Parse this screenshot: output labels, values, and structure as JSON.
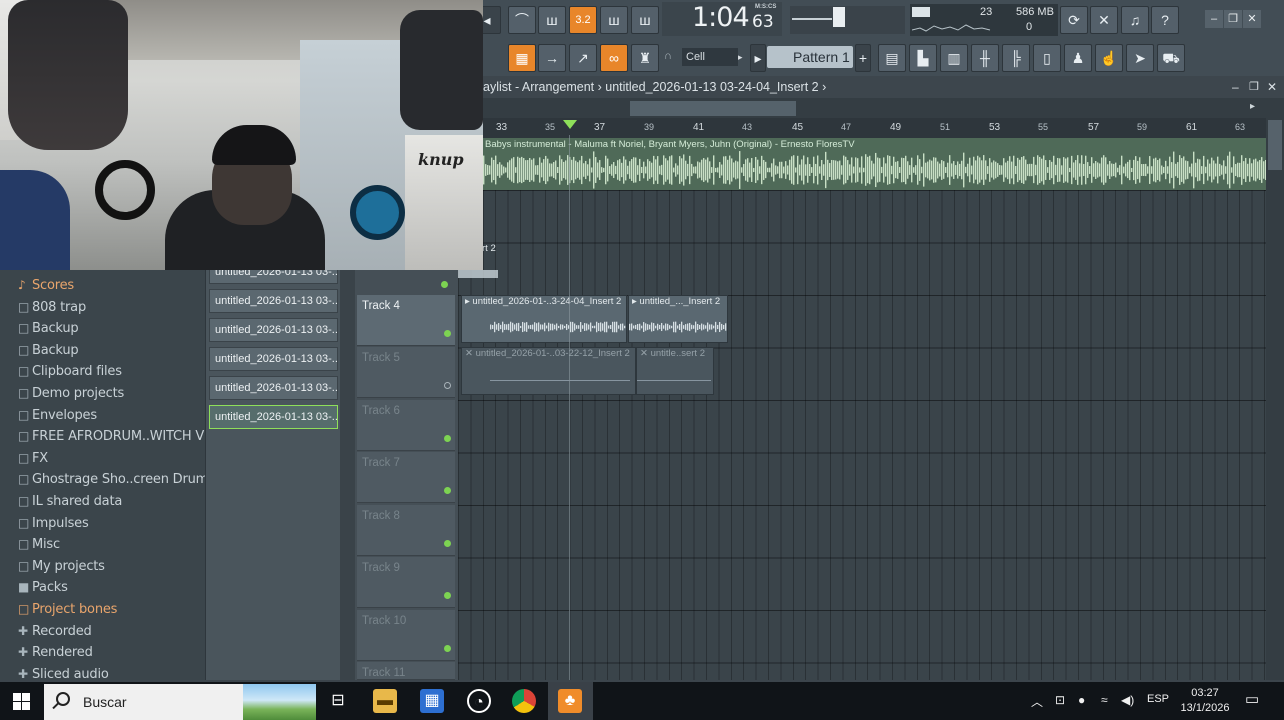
{
  "toolbar": {
    "time_main": "1:04",
    "time_sub": "63",
    "time_unit": "M:S:CS",
    "cpu_value": "23",
    "ram_value": "586 MB",
    "voices_value": "0",
    "snap_value": "Cell",
    "pattern_label": "Pattern 1",
    "tempo_snippet": "3.2"
  },
  "playlist": {
    "title": "aylist - Arrangement › untitled_2026-01-13 03-24-04_Insert 2 ›",
    "ruler": [
      "33",
      "35",
      "37",
      "39",
      "41",
      "43",
      "45",
      "47",
      "49",
      "51",
      "53",
      "55",
      "57",
      "59",
      "61",
      "63"
    ],
    "audio_track_label": "Babys instrumental - Maluma ft  Noriel, Bryant Myers, Juhn (Original) - Ernesto FloresTV",
    "partial_clip_label": "rt 2",
    "tracks": [
      {
        "name": "Track 4",
        "active": true
      },
      {
        "name": "Track 5",
        "active": false
      },
      {
        "name": "Track 6",
        "active": false
      },
      {
        "name": "Track 7",
        "active": false
      },
      {
        "name": "Track 8",
        "active": false
      },
      {
        "name": "Track 9",
        "active": false
      },
      {
        "name": "Track 10",
        "active": false
      },
      {
        "name": "Track 11",
        "active": false
      }
    ],
    "clips": {
      "track4_a": "▸ untitled_2026-01-..3-24-04_Insert 2",
      "track4_b": "▸ untitled_..._Insert 2",
      "track5_a": "✕ untitled_2026-01-..03-22-12_Insert 2",
      "track5_b": "✕ untitle..sert 2"
    }
  },
  "browser": {
    "items": [
      {
        "label": "Scores",
        "icon": "♪",
        "orange": true
      },
      {
        "label": "808 trap",
        "icon": "□",
        "orange": false
      },
      {
        "label": "Backup",
        "icon": "□",
        "orange": false
      },
      {
        "label": "Backup",
        "icon": "□",
        "orange": false
      },
      {
        "label": "Clipboard files",
        "icon": "□",
        "orange": false
      },
      {
        "label": "Demo projects",
        "icon": "□",
        "orange": false
      },
      {
        "label": "Envelopes",
        "icon": "□",
        "orange": false
      },
      {
        "label": "FREE AFRODRUM..WITCH VIBEZ",
        "icon": "□",
        "orange": false
      },
      {
        "label": "FX",
        "icon": "□",
        "orange": false
      },
      {
        "label": "Ghostrage Sho..creen Drum Kit",
        "icon": "□",
        "orange": false
      },
      {
        "label": "IL shared data",
        "icon": "□",
        "orange": false
      },
      {
        "label": "Impulses",
        "icon": "□",
        "orange": false
      },
      {
        "label": "Misc",
        "icon": "□",
        "orange": false
      },
      {
        "label": "My projects",
        "icon": "□",
        "orange": false
      },
      {
        "label": "Packs",
        "icon": "■",
        "orange": false
      },
      {
        "label": "Project bones",
        "icon": "□",
        "orange": true
      },
      {
        "label": "Recorded",
        "icon": "✚",
        "orange": false
      },
      {
        "label": "Rendered",
        "icon": "✚",
        "orange": false
      },
      {
        "label": "Sliced audio",
        "icon": "✚",
        "orange": false
      }
    ],
    "files": [
      "untitled_2026-01-13 03-...",
      "untitled_2026-01-13 03-...",
      "untitled_2026-01-13 03-...",
      "untitled_2026-01-13 03-...",
      "untitled_2026-01-13 03-...",
      "untitled_2026-01-13 03-..."
    ]
  },
  "webcam": {
    "box_text": "knup"
  },
  "taskbar": {
    "search_placeholder": "Buscar",
    "language": "ESP",
    "time": "03:27",
    "date": "13/1/2026"
  },
  "colors": {
    "accent_orange": "#e8862a",
    "accent_green": "#8ee05a",
    "audio_clip": "#4f6a58"
  }
}
